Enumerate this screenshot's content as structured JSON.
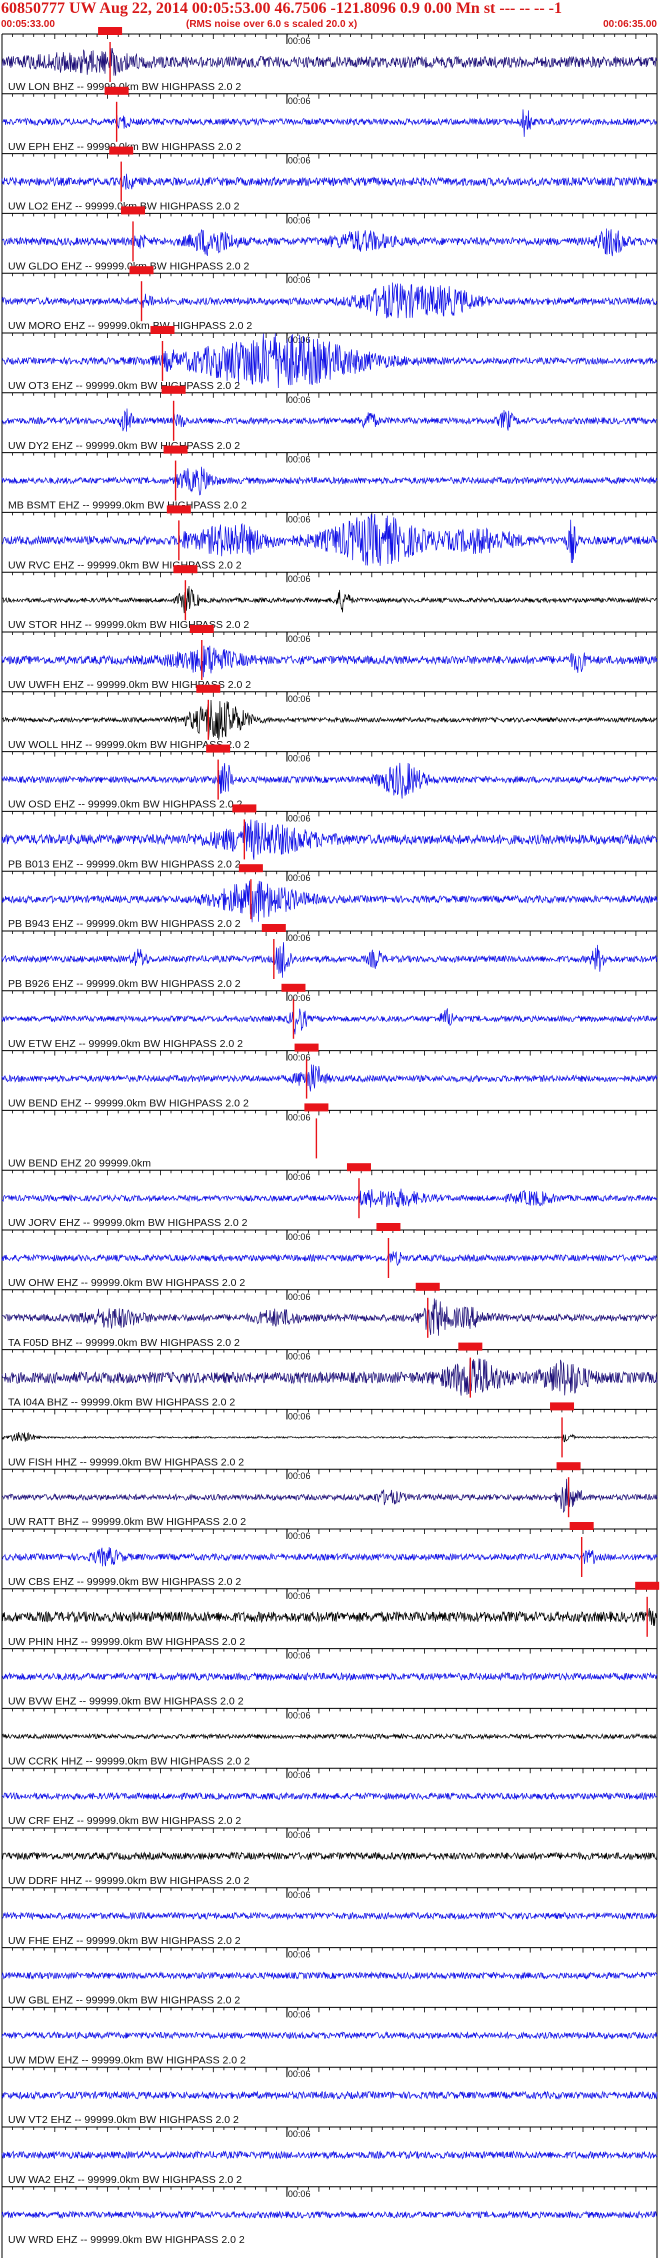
{
  "header": {
    "title": "60850777 UW Aug 22, 2014 00:05:53.00   46.7506 -121.8096  0.9 0.00 Mn st --- -- --  -1",
    "start_time": "00:05:33.00",
    "rms_note": "(RMS noise over 6.0 s scaled 20.0 x)",
    "end_time": "00:06:35.00"
  },
  "colors": {
    "text": "#111111",
    "header": "#d81a1a",
    "pick": "#e8141a",
    "trace_blue": "#1212e6",
    "trace_navy": "#1e1078",
    "trace_black": "#000000"
  },
  "chart_data": {
    "type": "line",
    "title": "60850777 UW Aug 22, 2014 00:05:53.00   46.7506 -121.8096  0.9 0.00 Mn st --- -- --  -1",
    "x_range": [
      "00:05:33.00",
      "00:06:35.00"
    ],
    "x_tick_label": "00:06",
    "series": [
      {
        "name": "UW LON BHZ -- 99999.0km BW  HIGHPASS  2.0  2",
        "pick": 0.165,
        "color": "navy",
        "amp": 0.35,
        "bursts": [
          [
            0.13,
            0.07,
            0.45
          ]
        ]
      },
      {
        "name": "UW EPH EHZ -- 99999.0km BW  HIGHPASS  2.0  2",
        "pick": 0.175,
        "color": "blue",
        "amp": 0.2,
        "bursts": [
          [
            0.8,
            0.006,
            1.1
          ]
        ]
      },
      {
        "name": "UW LO2 EHZ -- 99999.0km BW  HIGHPASS  2.0  2",
        "pick": 0.182,
        "color": "blue",
        "amp": 0.26,
        "bursts": []
      },
      {
        "name": "UW GLDO EHZ -- 99999.0km BW  HIGHPASS  2.0  2",
        "pick": 0.2,
        "color": "blue",
        "amp": 0.24,
        "bursts": [
          [
            0.32,
            0.03,
            0.75
          ],
          [
            0.55,
            0.04,
            0.5
          ],
          [
            0.93,
            0.02,
            0.7
          ]
        ]
      },
      {
        "name": "UW MORO EHZ -- 99999.0km BW  HIGHPASS  2.0  2",
        "pick": 0.213,
        "color": "blue",
        "amp": 0.22,
        "bursts": [
          [
            0.6,
            0.05,
            0.95
          ],
          [
            0.68,
            0.04,
            0.7
          ]
        ]
      },
      {
        "name": "UW OT3 EHZ -- 99999.0km BW  HIGHPASS  2.0  2",
        "pick": 0.245,
        "color": "blue",
        "amp": 0.2,
        "bursts": [
          [
            0.42,
            0.12,
            1.6
          ]
        ]
      },
      {
        "name": "UW DY2 EHZ -- 99999.0km BW  HIGHPASS  2.0  2",
        "pick": 0.262,
        "color": "blue",
        "amp": 0.2,
        "bursts": [
          [
            0.19,
            0.01,
            0.6
          ],
          [
            0.56,
            0.01,
            0.55
          ],
          [
            0.77,
            0.01,
            0.55
          ]
        ]
      },
      {
        "name": "MB BSMT EHZ -- 99999.0km BW  HIGHPASS  2.0  2",
        "pick": 0.265,
        "color": "blue",
        "amp": 0.2,
        "bursts": [
          [
            0.3,
            0.02,
            0.7
          ]
        ]
      },
      {
        "name": "UW RVC EHZ -- 99999.0km BW  HIGHPASS  2.0  2",
        "pick": 0.27,
        "color": "blue",
        "amp": 0.26,
        "bursts": [
          [
            0.35,
            0.05,
            0.9
          ],
          [
            0.57,
            0.07,
            1.4
          ],
          [
            0.73,
            0.05,
            0.6
          ],
          [
            0.87,
            0.006,
            1.3
          ]
        ]
      },
      {
        "name": "UW STOR HHZ -- 99999.0km BW  HIGHPASS  2.0  2",
        "pick": 0.28,
        "color": "black",
        "amp": 0.14,
        "bursts": [
          [
            0.28,
            0.01,
            0.7
          ],
          [
            0.52,
            0.01,
            0.65
          ]
        ]
      },
      {
        "name": "UW UWFH EHZ -- 99999.0km BW  HIGHPASS  2.0  2",
        "pick": 0.305,
        "color": "blue",
        "amp": 0.26,
        "bursts": [
          [
            0.31,
            0.05,
            0.6
          ],
          [
            0.88,
            0.01,
            0.6
          ]
        ]
      },
      {
        "name": "UW WOLL HHZ -- 99999.0km BW  HIGHPASS  2.0  2",
        "pick": 0.315,
        "color": "black",
        "amp": 0.14,
        "bursts": [
          [
            0.33,
            0.04,
            1.2
          ]
        ]
      },
      {
        "name": "UW OSD EHZ -- 99999.0km BW  HIGHPASS  2.0  2",
        "pick": 0.33,
        "color": "blue",
        "amp": 0.2,
        "bursts": [
          [
            0.34,
            0.01,
            0.8
          ],
          [
            0.61,
            0.03,
            1.0
          ]
        ]
      },
      {
        "name": "PB B013 EHZ -- 99999.0km BW  HIGHPASS  2.0  2",
        "pick": 0.37,
        "color": "blue",
        "amp": 0.3,
        "bursts": [
          [
            0.4,
            0.07,
            0.8
          ]
        ]
      },
      {
        "name": "PB B943 EHZ -- 99999.0km BW  HIGHPASS  2.0  2",
        "pick": 0.38,
        "color": "blue",
        "amp": 0.22,
        "bursts": [
          [
            0.39,
            0.06,
            1.0
          ]
        ]
      },
      {
        "name": "PB B926 EHZ -- 99999.0km BW  HIGHPASS  2.0  2",
        "pick": 0.415,
        "color": "blue",
        "amp": 0.2,
        "bursts": [
          [
            0.21,
            0.01,
            0.5
          ],
          [
            0.43,
            0.01,
            1.0
          ],
          [
            0.57,
            0.01,
            0.5
          ],
          [
            0.91,
            0.01,
            0.7
          ]
        ]
      },
      {
        "name": "UW ETW EHZ -- 99999.0km BW  HIGHPASS  2.0  2",
        "pick": 0.445,
        "color": "blue",
        "amp": 0.18,
        "bursts": [
          [
            0.45,
            0.01,
            0.6
          ],
          [
            0.68,
            0.01,
            0.5
          ]
        ]
      },
      {
        "name": "UW BEND EHZ -- 99999.0km BW  HIGHPASS  2.0  2",
        "pick": 0.465,
        "color": "blue",
        "amp": 0.2,
        "bursts": [
          [
            0.47,
            0.02,
            0.55
          ]
        ]
      },
      {
        "name": "UW BEND EHZ 20 99999.0km",
        "pick": 0.48,
        "color": "blue",
        "amp": 0.0,
        "bursts": []
      },
      {
        "name": "UW JORV EHZ -- 99999.0km BW  HIGHPASS  2.0  2",
        "pick": 0.545,
        "color": "blue",
        "amp": 0.18,
        "bursts": [
          [
            0.6,
            0.04,
            0.45
          ],
          [
            0.81,
            0.03,
            0.35
          ]
        ]
      },
      {
        "name": "UW OHW EHZ -- 99999.0km BW  HIGHPASS  2.0  2",
        "pick": 0.59,
        "color": "blue",
        "amp": 0.2,
        "bursts": []
      },
      {
        "name": "TA F05D BHZ -- 99999.0km BW  HIGHPASS  2.0  2",
        "pick": 0.65,
        "color": "navy",
        "amp": 0.22,
        "bursts": [
          [
            0.17,
            0.04,
            0.5
          ],
          [
            0.42,
            0.03,
            0.4
          ],
          [
            0.66,
            0.02,
            0.8
          ],
          [
            0.71,
            0.03,
            0.5
          ]
        ]
      },
      {
        "name": "TA I04A BHZ -- 99999.0km BW  HIGHPASS  2.0  2",
        "pick": 0.715,
        "color": "navy",
        "amp": 0.35,
        "bursts": [
          [
            0.72,
            0.04,
            1.0
          ],
          [
            0.86,
            0.03,
            0.9
          ]
        ]
      },
      {
        "name": "UW FISH HHZ -- 99999.0km BW  HIGHPASS  2.0  2",
        "pick": 0.855,
        "color": "black",
        "amp": 0.05,
        "bursts": [
          [
            0.03,
            0.02,
            0.3
          ]
        ]
      },
      {
        "name": "UW RATT BHZ -- 99999.0km BW  HIGHPASS  2.0  2",
        "pick": 0.865,
        "color": "navy",
        "amp": 0.18,
        "bursts": [
          [
            0.59,
            0.02,
            0.35
          ],
          [
            0.86,
            0.01,
            1.0
          ]
        ]
      },
      {
        "name": "UW CBS EHZ -- 99999.0km BW  HIGHPASS  2.0  2",
        "pick": 0.885,
        "color": "blue",
        "amp": 0.2,
        "bursts": [
          [
            0.16,
            0.02,
            0.45
          ]
        ]
      },
      {
        "name": "UW PHIN HHZ -- 99999.0km BW  HIGHPASS  2.0  2",
        "pick": 0.985,
        "color": "black",
        "amp": 0.32,
        "bursts": []
      },
      {
        "name": "UW BVW EHZ -- 99999.0km BW  HIGHPASS  2.0  2",
        "pick": null,
        "color": "blue",
        "amp": 0.22,
        "bursts": []
      },
      {
        "name": "UW CCRK HHZ -- 99999.0km BW  HIGHPASS  2.0  2",
        "pick": null,
        "color": "black",
        "amp": 0.14,
        "bursts": []
      },
      {
        "name": "UW CRF EHZ -- 99999.0km BW  HIGHPASS  2.0  2",
        "pick": null,
        "color": "blue",
        "amp": 0.2,
        "bursts": []
      },
      {
        "name": "UW DDRF HHZ -- 99999.0km BW  HIGHPASS  2.0  2",
        "pick": null,
        "color": "black",
        "amp": 0.22,
        "bursts": []
      },
      {
        "name": "UW FHE EHZ -- 99999.0km BW  HIGHPASS  2.0  2",
        "pick": null,
        "color": "blue",
        "amp": 0.2,
        "bursts": []
      },
      {
        "name": "UW GBL EHZ -- 99999.0km BW  HIGHPASS  2.0  2",
        "pick": null,
        "color": "blue",
        "amp": 0.2,
        "bursts": []
      },
      {
        "name": "UW MDW EHZ -- 99999.0km BW  HIGHPASS  2.0  2",
        "pick": null,
        "color": "blue",
        "amp": 0.2,
        "bursts": []
      },
      {
        "name": "UW VT2 EHZ -- 99999.0km BW  HIGHPASS  2.0  2",
        "pick": null,
        "color": "blue",
        "amp": 0.22,
        "bursts": []
      },
      {
        "name": "UW WA2 EHZ -- 99999.0km BW  HIGHPASS  2.0  2",
        "pick": null,
        "color": "blue",
        "amp": 0.22,
        "bursts": []
      },
      {
        "name": "UW WRD EHZ -- 99999.0km BW  HIGHPASS  2.0  2",
        "pick": null,
        "color": "blue",
        "amp": 0.2,
        "bursts": []
      }
    ]
  }
}
